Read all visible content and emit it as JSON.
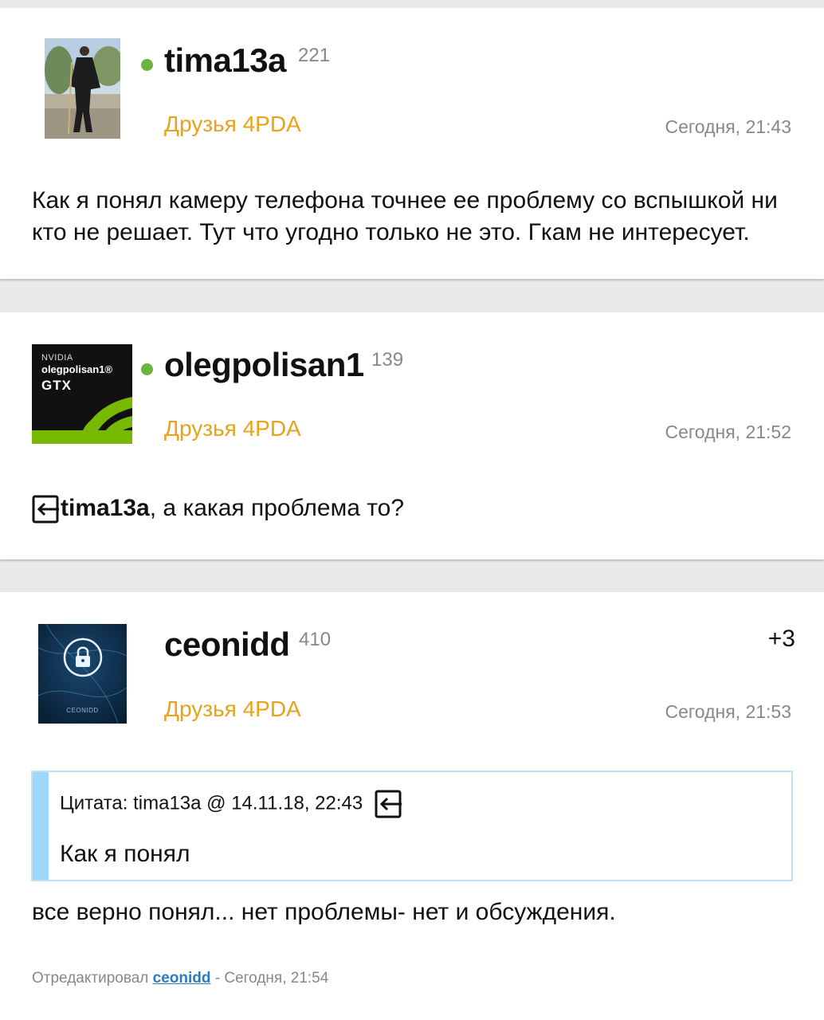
{
  "posts": [
    {
      "username": "tima13a",
      "reputation": "221",
      "group": "Друзья 4PDA",
      "time": "Сегодня, 21:43",
      "online": true,
      "text": "Как я понял камеру телефона точнее ее проблему со вспышкой ни кто не решает. Тут что угодно только не это. Гкам не интересует."
    },
    {
      "username": "olegpolisan1",
      "reputation": "139",
      "group": "Друзья 4PDA",
      "time": "Сегодня, 21:52",
      "online": true,
      "avatar_text": {
        "brand": "NVIDIA",
        "name": "olegpolisan1®",
        "model": "GTX"
      },
      "mention": "tima13a",
      "text": ", а какая проблема то?"
    },
    {
      "username": "ceonidd",
      "reputation": "410",
      "group": "Друзья 4PDA",
      "time": "Сегодня, 21:53",
      "online": false,
      "rating": "+3",
      "avatar_text": "CEONIDD",
      "quote": {
        "header": "Цитата: tima13a @ 14.11.18, 22:43",
        "text": "Как я понял"
      },
      "text": "все верно понял... нет проблемы- нет и обсуждения.",
      "edited": {
        "prefix": "Отредактировал",
        "user": "ceonidd",
        "suffix": "- Сегодня, 21:54"
      }
    }
  ],
  "colors": {
    "online": "#6db33f",
    "group": "#e8a21b",
    "quote_bar": "#9fd6fb",
    "link": "#2a7bbf",
    "nvidia_green": "#76b900"
  },
  "icons": [
    "reply-icon",
    "lock-icon"
  ]
}
